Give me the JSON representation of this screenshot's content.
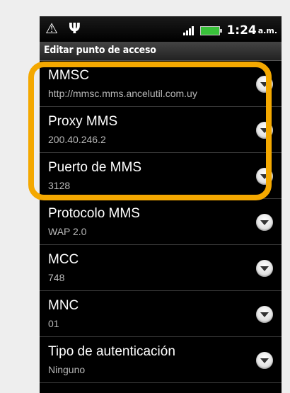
{
  "statusbar": {
    "time": "1:24",
    "ampm": "a.m.",
    "icons": [
      "warning-icon",
      "usb-icon",
      "signal-icon",
      "battery-icon"
    ]
  },
  "titlebar": {
    "title": "Editar punto de acceso"
  },
  "items": [
    {
      "title": "MMSC",
      "value": "http://mmsc.mms.ancelutil.com.uy"
    },
    {
      "title": "Proxy MMS",
      "value": "200.40.246.2"
    },
    {
      "title": "Puerto de MMS",
      "value": "3128"
    },
    {
      "title": "Protocolo MMS",
      "value": "WAP 2.0"
    },
    {
      "title": "MCC",
      "value": "748"
    },
    {
      "title": "MNC",
      "value": "01"
    },
    {
      "title": "Tipo de autenticación",
      "value": "Ninguno"
    }
  ],
  "highlight_color": "#f4a800"
}
